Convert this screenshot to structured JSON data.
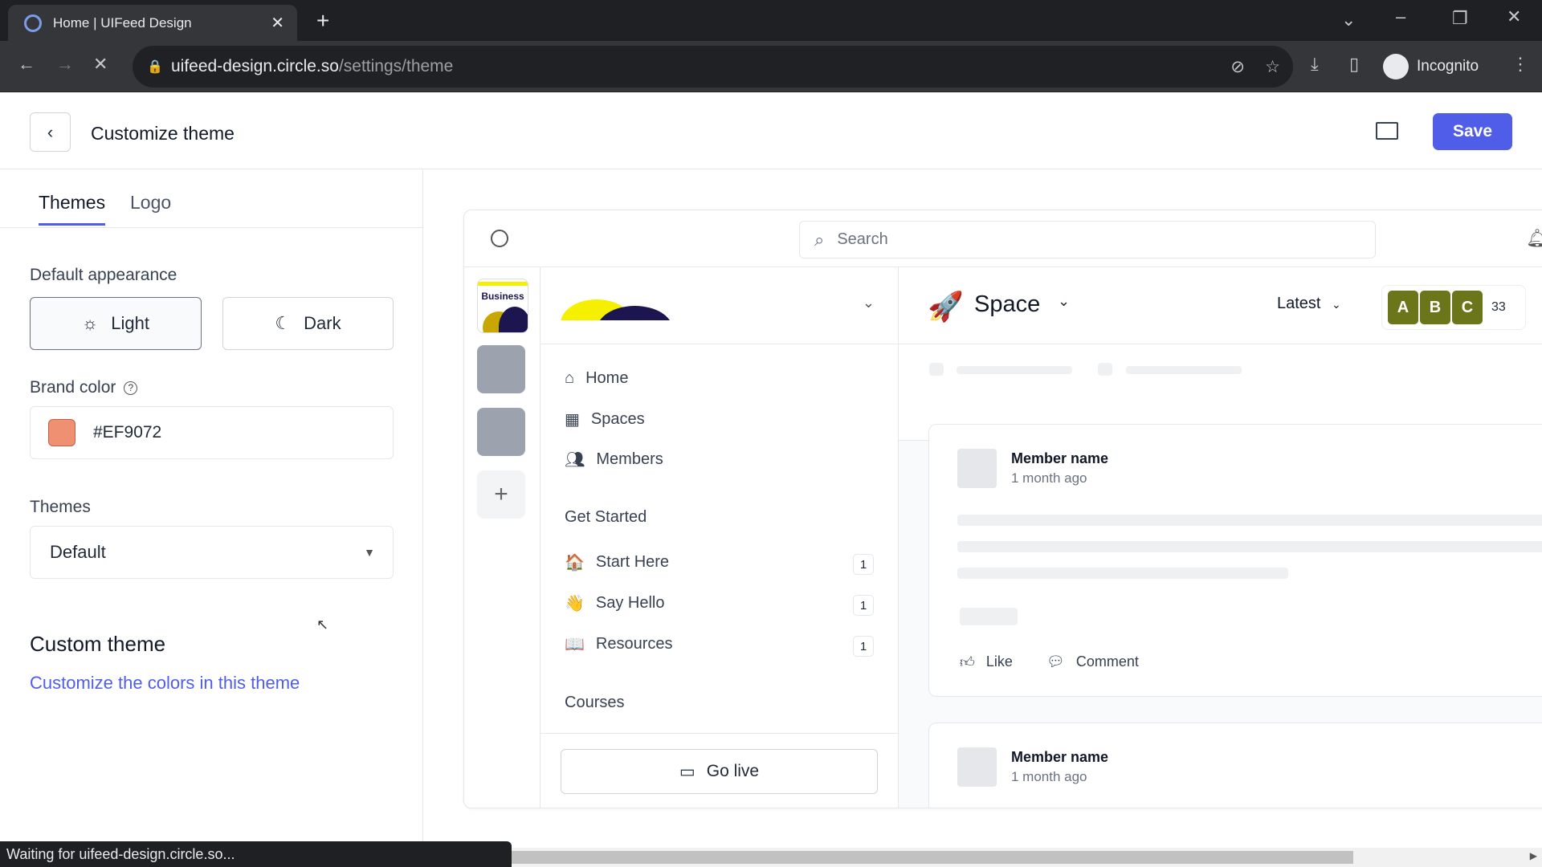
{
  "browser": {
    "tab_title": "Home | UIFeed Design",
    "url_host": "uifeed-design.circle.so",
    "url_path": "/settings/theme",
    "profile": "Incognito",
    "status": "Waiting for uifeed-design.circle.so..."
  },
  "header": {
    "title": "Customize theme",
    "save_label": "Save"
  },
  "left": {
    "tabs": [
      {
        "label": "Themes",
        "active": true
      },
      {
        "label": "Logo",
        "active": false
      }
    ],
    "appearance_label": "Default appearance",
    "light_label": "Light",
    "dark_label": "Dark",
    "selected_appearance": "Light",
    "brand_color_label": "Brand color",
    "brand_color": "#EF9072",
    "themes_label": "Themes",
    "theme_value": "Default",
    "custom_title": "Custom theme",
    "custom_link": "Customize the colors in this theme"
  },
  "preview": {
    "search_placeholder": "Search",
    "rail_label": "Business",
    "nav": [
      {
        "label": "Home",
        "icon": "home-icon"
      },
      {
        "label": "Spaces",
        "icon": "grid-icon"
      },
      {
        "label": "Members",
        "icon": "users-icon"
      }
    ],
    "group": "Get Started",
    "spaces": [
      {
        "label": "Start Here",
        "emoji": "🏠",
        "count": "1"
      },
      {
        "label": "Say Hello",
        "emoji": "👋",
        "count": "1"
      },
      {
        "label": "Resources",
        "emoji": "📖",
        "count": "1"
      }
    ],
    "courses": "Courses",
    "go_live": "Go live",
    "space_title": "Space",
    "sort": "Latest",
    "avatars": [
      "A",
      "B",
      "C"
    ],
    "member_count": "33",
    "posts": [
      {
        "name": "Member name",
        "time": "1 month ago"
      },
      {
        "name": "Member name",
        "time": "1 month ago"
      }
    ],
    "like": "Like",
    "comment": "Comment"
  },
  "colors": {
    "accent": "#4f5de8",
    "link": "#4f5de8",
    "avatar": "#6b7519"
  }
}
